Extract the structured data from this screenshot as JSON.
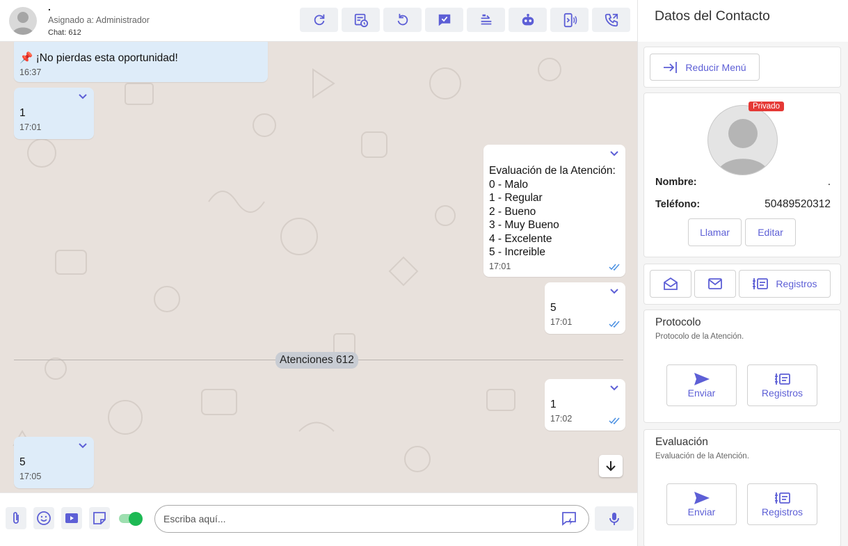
{
  "header": {
    "contact_name": ".",
    "assigned": "Asignado a: Administrador",
    "chat_id": "Chat: 612",
    "toolbar_icons": [
      "refresh-icon",
      "schedule-icon",
      "undo-icon",
      "resolve-icon",
      "transfer-icon",
      "bot-icon",
      "device-icon",
      "call-icon"
    ]
  },
  "messages": [
    {
      "direction": "in",
      "text": "📌 ¡No pierdas esta oportunidad!",
      "time": "16:37"
    },
    {
      "direction": "in",
      "text": "1",
      "time": "17:01"
    },
    {
      "direction": "out",
      "text": "Evaluación de la Atención:\n0 - Malo\n1 - Regular\n2 - Bueno\n3 - Muy Bueno\n4 - Excelente\n5 - Increible",
      "time": "17:01"
    },
    {
      "direction": "out",
      "text": "5",
      "time": "17:01"
    },
    {
      "direction": "out",
      "text": "1",
      "time": "17:02"
    },
    {
      "direction": "in",
      "text": "5",
      "time": "17:05"
    }
  ],
  "separator": "Atenciones 612",
  "composer": {
    "placeholder": "Escriba aquí..."
  },
  "panel": {
    "title": "Datos del Contacto",
    "reduce_menu": "Reducir Menú",
    "badge": "Privado",
    "name_label": "Nombre:",
    "name_value": ".",
    "phone_label": "Teléfono:",
    "phone_value": "50489520312",
    "call": "Llamar",
    "edit": "Editar",
    "records": "Registros",
    "protocol": {
      "title": "Protocolo",
      "subtitle": "Protocolo de la Atención.",
      "send": "Enviar",
      "records": "Registros"
    },
    "evaluation": {
      "title": "Evaluación",
      "subtitle": "Evaluación de la Atención.",
      "send": "Enviar",
      "records": "Registros"
    }
  },
  "colors": {
    "accent": "#5d5fd6",
    "bubble_in": "#deecf9",
    "bubble_out": "#ffffff",
    "badge": "#e53935",
    "toggle": "#1db954",
    "wallpaper": "#e8e1dc"
  }
}
